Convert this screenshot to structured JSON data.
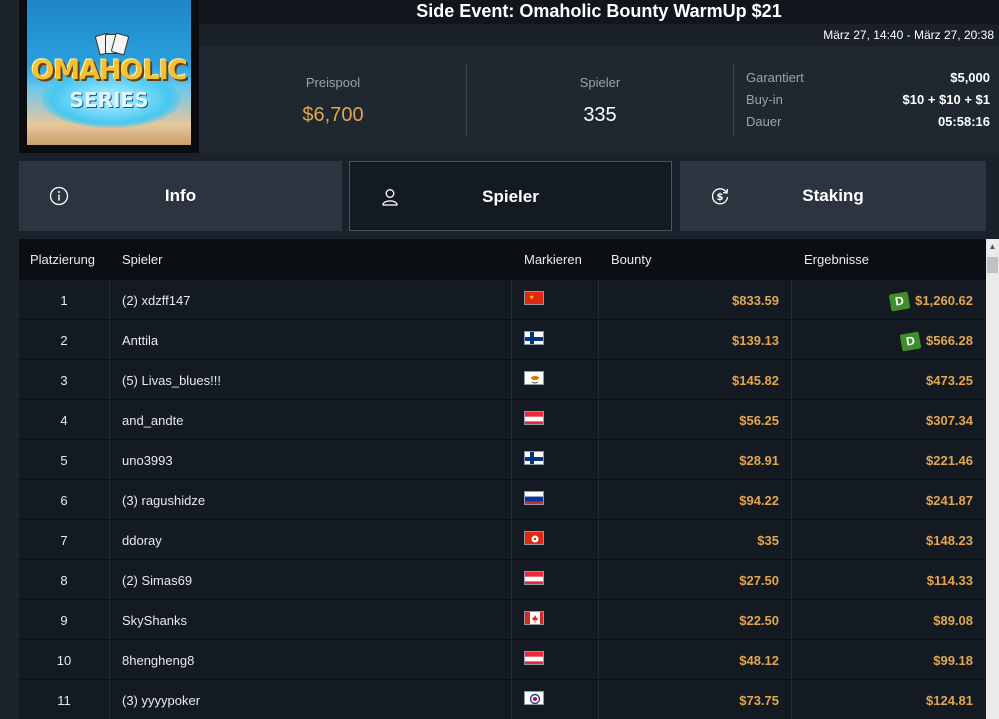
{
  "header": {
    "title": "Side Event: Omaholic Bounty WarmUp $21",
    "dates": "März 27, 14:40 - März 27, 20:38",
    "logo_line1": "OMAHOLIC",
    "logo_line2": "SERIES"
  },
  "stats": {
    "prizepool_label": "Preispool",
    "prizepool_value": "$6,700",
    "players_label": "Spieler",
    "players_value": "335",
    "details": [
      {
        "label": "Garantiert",
        "value": "$5,000"
      },
      {
        "label": "Buy-in",
        "value": "$10 + $10 + $1"
      },
      {
        "label": "Dauer",
        "value": "05:58:16"
      }
    ]
  },
  "tabs": [
    {
      "label": "Info",
      "icon": "info-icon",
      "active": false
    },
    {
      "label": "Spieler",
      "icon": "user-icon",
      "active": true
    },
    {
      "label": "Staking",
      "icon": "dollar-refresh-icon",
      "active": false
    }
  ],
  "table": {
    "columns": [
      "Platzierung",
      "Spieler",
      "Markieren",
      "Bounty",
      "Ergebnisse"
    ],
    "rows": [
      {
        "rank": "1",
        "player": "(2) xdzff147",
        "flag": "china-flag",
        "bounty": "$833.59",
        "result": "$1,260.62",
        "badge": "D"
      },
      {
        "rank": "2",
        "player": "Anttila",
        "flag": "finland-flag",
        "bounty": "$139.13",
        "result": "$566.28",
        "badge": "D"
      },
      {
        "rank": "3",
        "player": "(5) Livas_blues!!!",
        "flag": "cyprus-flag",
        "bounty": "$145.82",
        "result": "$473.25",
        "badge": ""
      },
      {
        "rank": "4",
        "player": "and_andte",
        "flag": "austria-flag",
        "bounty": "$56.25",
        "result": "$307.34",
        "badge": ""
      },
      {
        "rank": "5",
        "player": "uno3993",
        "flag": "finland-flag",
        "bounty": "$28.91",
        "result": "$221.46",
        "badge": ""
      },
      {
        "rank": "6",
        "player": "(3) ragushidze",
        "flag": "russia-flag",
        "bounty": "$94.22",
        "result": "$241.87",
        "badge": ""
      },
      {
        "rank": "7",
        "player": "ddoray",
        "flag": "hongkong-flag",
        "bounty": "$35",
        "result": "$148.23",
        "badge": ""
      },
      {
        "rank": "8",
        "player": "(2) Simas69",
        "flag": "austria-flag",
        "bounty": "$27.50",
        "result": "$114.33",
        "badge": ""
      },
      {
        "rank": "9",
        "player": "SkyShanks",
        "flag": "canada-flag",
        "bounty": "$22.50",
        "result": "$89.08",
        "badge": ""
      },
      {
        "rank": "10",
        "player": "8hengheng8",
        "flag": "austria-flag",
        "bounty": "$48.12",
        "result": "$99.18",
        "badge": ""
      },
      {
        "rank": "11",
        "player": "(3) yyyypoker",
        "flag": "taiwan-flag",
        "bounty": "$73.75",
        "result": "$124.81",
        "badge": ""
      }
    ]
  },
  "colors": {
    "accent_gold": "#e2a650",
    "badge_green": "#3f8d2d"
  }
}
